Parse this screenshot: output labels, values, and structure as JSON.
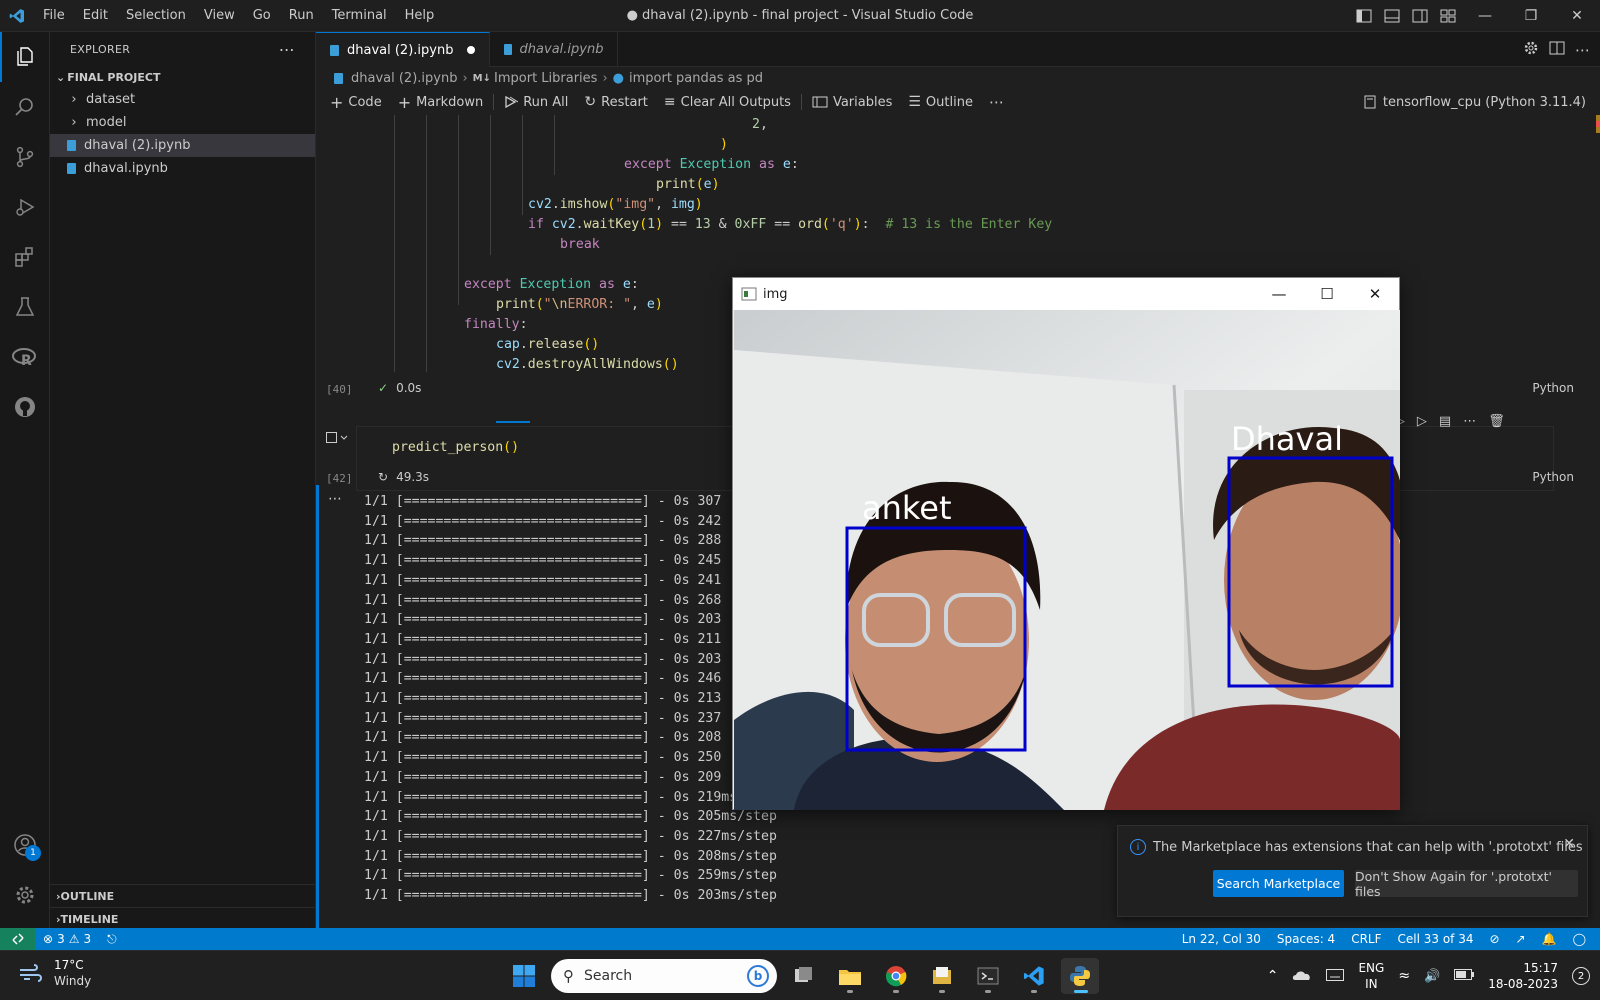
{
  "window": {
    "title": "● dhaval (2).ipynb - final project - Visual Studio Code",
    "menu": [
      "File",
      "Edit",
      "Selection",
      "View",
      "Go",
      "Run",
      "Terminal",
      "Help"
    ]
  },
  "sidebar": {
    "header": "EXPLORER",
    "section": "FINAL PROJECT",
    "items": [
      {
        "label": "dataset",
        "type": "folder"
      },
      {
        "label": "model",
        "type": "folder"
      },
      {
        "label": "dhaval (2).ipynb",
        "type": "notebook",
        "selected": true
      },
      {
        "label": "dhaval.ipynb",
        "type": "notebook"
      }
    ],
    "outline": "OUTLINE",
    "timeline": "TIMELINE",
    "accounts_badge": "1"
  },
  "tabs": [
    {
      "label": "dhaval (2).ipynb",
      "active": true,
      "dirty": true
    },
    {
      "label": "dhaval.ipynb",
      "active": false
    }
  ],
  "breadcrumb": [
    "dhaval (2).ipynb",
    "Import Libraries",
    "import pandas as pd"
  ],
  "breadcrumb_md_prefix": "M↓",
  "toolbar": {
    "code": "Code",
    "markdown": "Markdown",
    "run_all": "Run All",
    "restart": "Restart",
    "clear_outputs": "Clear All Outputs",
    "variables": "Variables",
    "outline": "Outline",
    "kernel": "tensorflow_cpu (Python 3.11.4)"
  },
  "cell1": {
    "exec_count": "[40]",
    "duration": "0.0s",
    "language": "Python"
  },
  "cell2": {
    "code": "predict_person()",
    "exec_count": "[42]",
    "duration": "49.3s",
    "language": "Python"
  },
  "output_lines": [
    {
      "bar": "1/1 [==============================] - 0s",
      "ms": "307"
    },
    {
      "bar": "1/1 [==============================] - 0s",
      "ms": "242"
    },
    {
      "bar": "1/1 [==============================] - 0s",
      "ms": "288"
    },
    {
      "bar": "1/1 [==============================] - 0s",
      "ms": "245"
    },
    {
      "bar": "1/1 [==============================] - 0s",
      "ms": "241"
    },
    {
      "bar": "1/1 [==============================] - 0s",
      "ms": "268"
    },
    {
      "bar": "1/1 [==============================] - 0s",
      "ms": "203"
    },
    {
      "bar": "1/1 [==============================] - 0s",
      "ms": "211"
    },
    {
      "bar": "1/1 [==============================] - 0s",
      "ms": "203"
    },
    {
      "bar": "1/1 [==============================] - 0s",
      "ms": "246"
    },
    {
      "bar": "1/1 [==============================] - 0s",
      "ms": "213"
    },
    {
      "bar": "1/1 [==============================] - 0s",
      "ms": "237"
    },
    {
      "bar": "1/1 [==============================] - 0s",
      "ms": "208"
    },
    {
      "bar": "1/1 [==============================] - 0s",
      "ms": "250"
    },
    {
      "bar": "1/1 [==============================] - 0s",
      "ms": "209"
    },
    {
      "bar": "1/1 [==============================] - 0s",
      "ms": "219ms/step"
    },
    {
      "bar": "1/1 [==============================] - 0s",
      "ms": "205ms/step"
    },
    {
      "bar": "1/1 [==============================] - 0s",
      "ms": "227ms/step"
    },
    {
      "bar": "1/1 [==============================] - 0s",
      "ms": "208ms/step"
    },
    {
      "bar": "1/1 [==============================] - 0s",
      "ms": "259ms/step"
    },
    {
      "bar": "1/1 [==============================] - 0s",
      "ms": "203ms/step"
    }
  ],
  "img_window": {
    "title": "img",
    "label_left": "anket",
    "label_right": "Dhaval",
    "box_color": "#0000cc"
  },
  "notification": {
    "message": "The Marketplace has extensions that can help with '.prototxt' files",
    "primary": "Search Marketplace",
    "secondary": "Don't Show Again for '.prototxt' files"
  },
  "statusbar": {
    "errors": "3",
    "warnings": "3",
    "position": "Ln 22, Col 30",
    "spaces": "Spaces: 4",
    "eol": "CRLF",
    "cell": "Cell 33 of 34"
  },
  "taskbar": {
    "temp": "17°C",
    "weather": "Windy",
    "search": "Search",
    "lang1": "ENG",
    "lang2": "IN",
    "time": "15:17",
    "date": "18-08-2023",
    "notif_count": "2"
  },
  "colors": {
    "accent": "#0078d4",
    "statusbar": "#007acc",
    "remote": "#16825d"
  }
}
